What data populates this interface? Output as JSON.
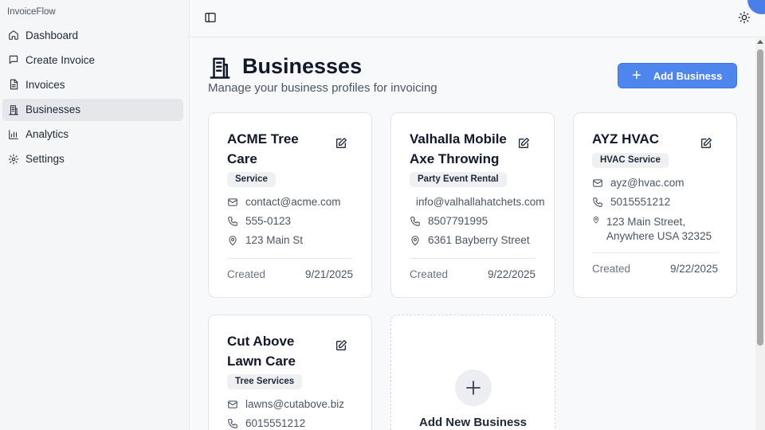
{
  "app": {
    "name": "InvoiceFlow"
  },
  "nav": [
    {
      "label": "Dashboard",
      "icon": "home-icon",
      "active": false
    },
    {
      "label": "Create Invoice",
      "icon": "chat-square-icon",
      "active": false
    },
    {
      "label": "Invoices",
      "icon": "file-text-icon",
      "active": false
    },
    {
      "label": "Businesses",
      "icon": "building-icon",
      "active": true
    },
    {
      "label": "Analytics",
      "icon": "bar-chart-icon",
      "active": false
    },
    {
      "label": "Settings",
      "icon": "gear-icon",
      "active": false
    }
  ],
  "header": {
    "title": "Businesses",
    "subtitle": "Manage your business profiles for invoicing",
    "add_button": "Add Business"
  },
  "cards": [
    {
      "name": "ACME Tree Care",
      "type": "Service",
      "email": "contact@acme.com",
      "phone": "555-0123",
      "address": "123 Main St",
      "created_label": "Created",
      "created": "9/21/2025"
    },
    {
      "name": "Valhalla Mobile Axe Throwing",
      "type": "Party Event Rental",
      "email": "info@valhallahatchets.com",
      "phone": "8507791995",
      "address": "6361 Bayberry Street",
      "created_label": "Created",
      "created": "9/22/2025"
    },
    {
      "name": "AYZ HVAC",
      "type": "HVAC Service",
      "email": "ayz@hvac.com",
      "phone": "5015551212",
      "address": "123 Main Street, Anywhere USA 32325",
      "created_label": "Created",
      "created": "9/22/2025"
    },
    {
      "name": "Cut Above Lawn Care",
      "type": "Tree Services",
      "email": "lawns@cutabove.biz",
      "phone": "6015551212"
    }
  ],
  "new_card": {
    "label": "Add New Business"
  },
  "colors": {
    "accent": "#4f86ed",
    "sidebar_bg": "#f5f6f7",
    "active_nav_bg": "#e6e7ea"
  }
}
